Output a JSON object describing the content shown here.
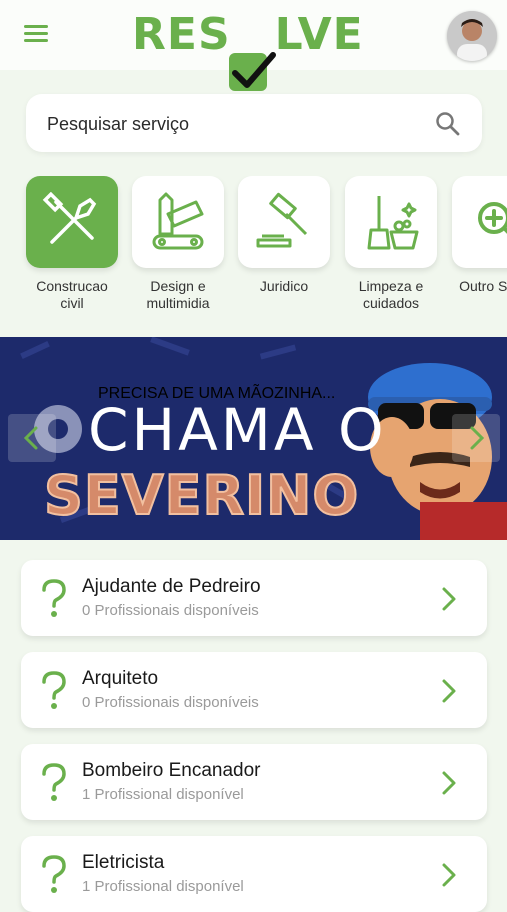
{
  "header": {
    "logo_text": "RESOLVE",
    "menu_icon": "hamburger-menu-icon",
    "avatar_alt": "user-avatar"
  },
  "search": {
    "placeholder": "Pesquisar serviço",
    "icon": "search-icon"
  },
  "categories": [
    {
      "label": "Construcao civil",
      "icon": "tools-icon",
      "active": true
    },
    {
      "label": "Design e multimidia",
      "icon": "design-tools-icon",
      "active": false
    },
    {
      "label": "Juridico",
      "icon": "gavel-icon",
      "active": false
    },
    {
      "label": "Limpeza e cuidados",
      "icon": "cleaning-icon",
      "active": false
    },
    {
      "label": "Outro Serviç",
      "icon": "add-search-icon",
      "active": false
    }
  ],
  "banner": {
    "small_text": "PRECISA DE UMA MÃOZINHA...",
    "title_line1": "CHAMA O",
    "title_line2": "SEVERINO"
  },
  "services": [
    {
      "title": "Ajudante de Pedreiro",
      "subtitle": "0 Profissionais disponíveis"
    },
    {
      "title": "Arquiteto",
      "subtitle": "0 Profissionais disponíveis"
    },
    {
      "title": "Bombeiro Encanador",
      "subtitle": "1 Profissional disponível"
    },
    {
      "title": "Eletricista",
      "subtitle": "1 Profissional disponível"
    }
  ],
  "colors": {
    "brand_green": "#6ab04c",
    "background": "#f1f7ee",
    "banner_navy": "#1d2a6b"
  }
}
